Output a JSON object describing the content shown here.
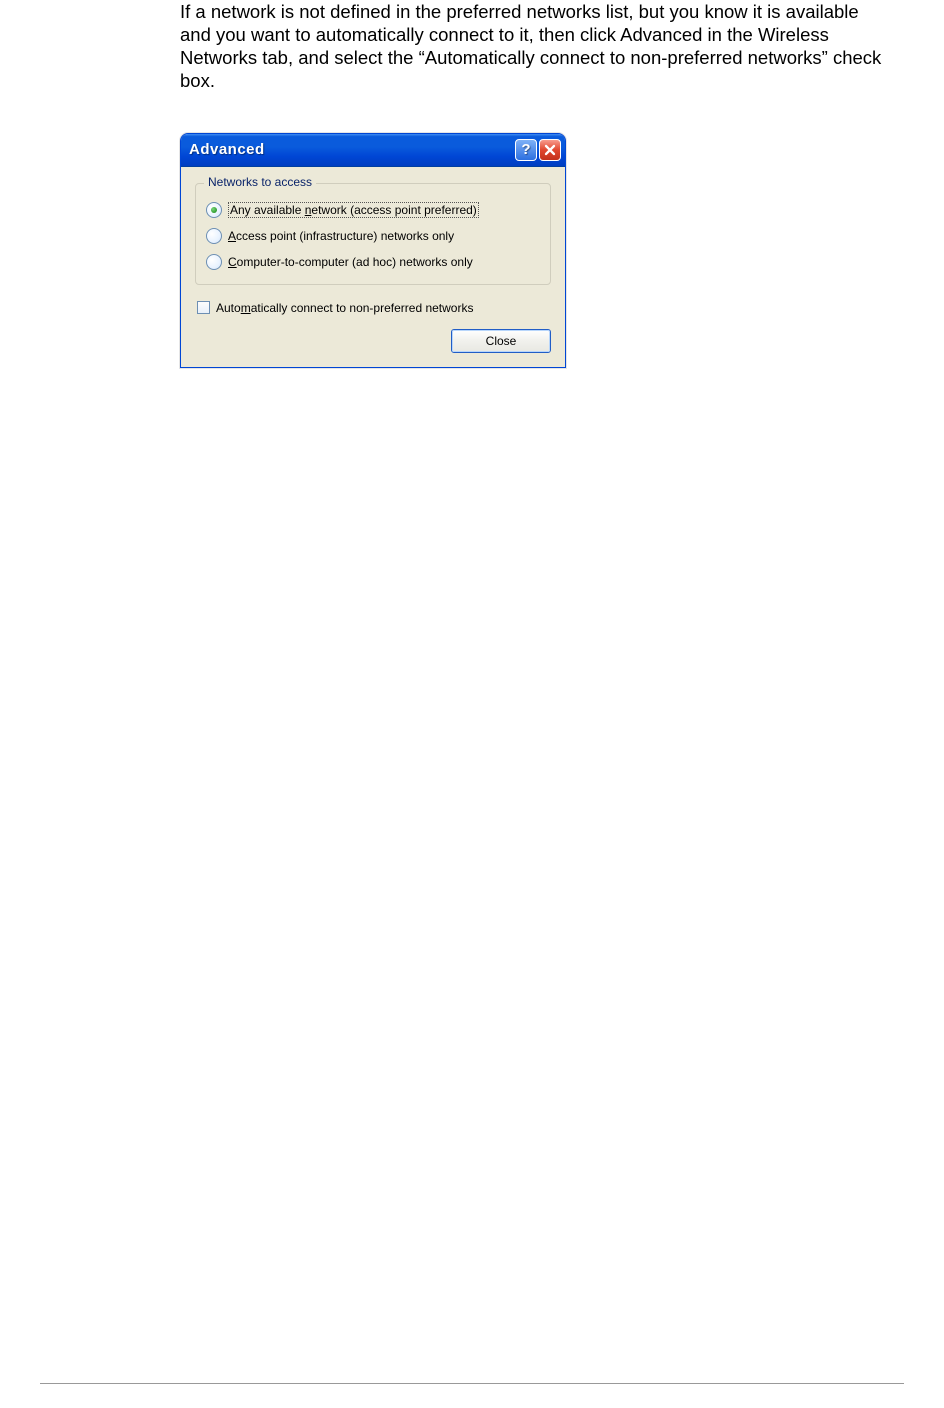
{
  "intro_text": "If a network is not defined in the preferred networks list, but you know it is available and you want to automatically connect to it, then click Advanced in the Wireless Networks tab, and select the “Automatically connect to non-preferred networks” check box.",
  "dialog": {
    "title": "Advanced",
    "help_glyph": "?",
    "group_legend": "Networks to access",
    "options": [
      {
        "pre": "Any available ",
        "hint": "n",
        "post": "etwork (access point preferred)",
        "selected": true,
        "focused": true
      },
      {
        "pre": "",
        "hint": "A",
        "post": "ccess point (infrastructure) networks only",
        "selected": false,
        "focused": false
      },
      {
        "pre": "",
        "hint": "C",
        "post": "omputer-to-computer (ad hoc) networks only",
        "selected": false,
        "focused": false
      }
    ],
    "checkbox": {
      "pre": "Auto",
      "hint": "m",
      "post": "atically connect to non-preferred networks",
      "checked": false
    },
    "close_button": "Close"
  }
}
